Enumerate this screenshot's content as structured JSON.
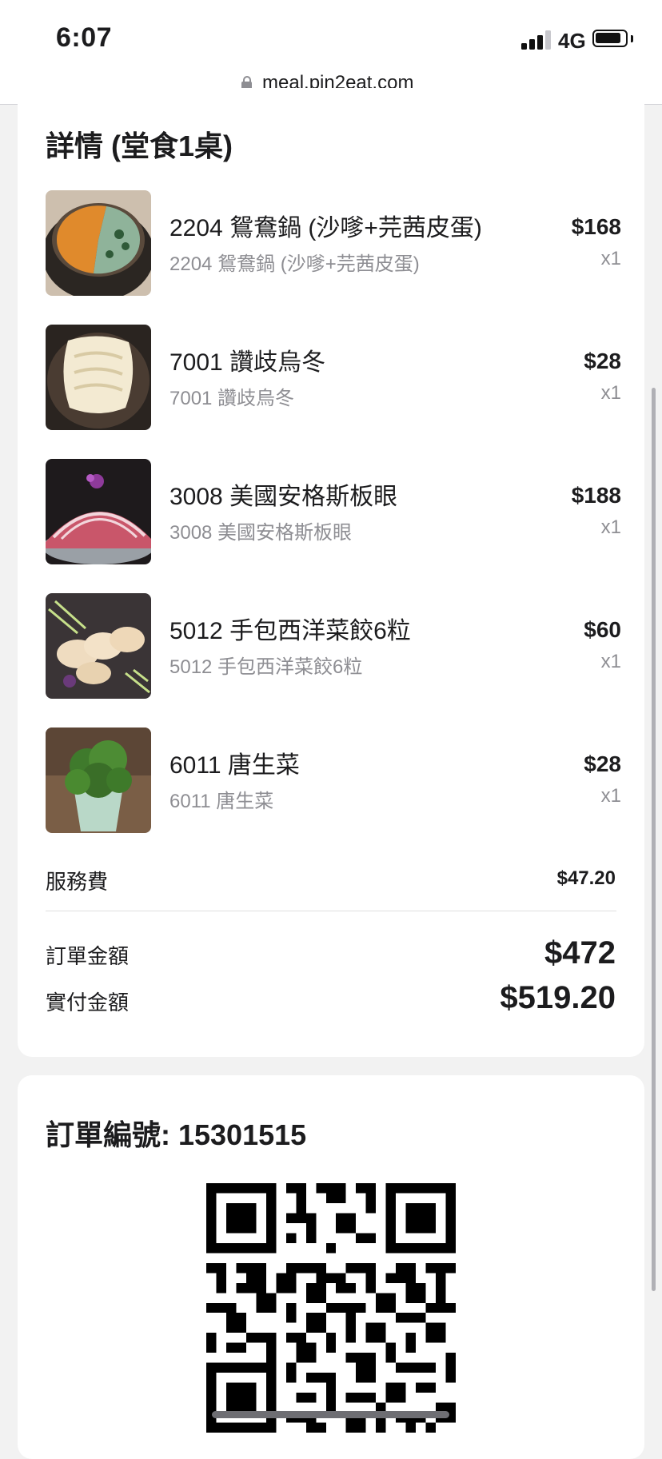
{
  "status_bar": {
    "time": "6:07",
    "network": "4G"
  },
  "url_bar": {
    "url": "meal.pin2eat.com"
  },
  "details": {
    "title": "詳情 (堂食1桌)",
    "items": [
      {
        "name": "2204 鴛鴦鍋 (沙嗲+芫茜皮蛋)",
        "subtitle": "2204 鴛鴦鍋 (沙嗲+芫茜皮蛋)",
        "price": "$168",
        "qty": "x1",
        "image": "hotpot-broth-image"
      },
      {
        "name": "7001 讚歧烏冬",
        "subtitle": "7001 讚歧烏冬",
        "price": "$28",
        "qty": "x1",
        "image": "udon-noodle-image"
      },
      {
        "name": "3008 美國安格斯板眼",
        "subtitle": "3008 美國安格斯板眼",
        "price": "$188",
        "qty": "x1",
        "image": "sliced-beef-image"
      },
      {
        "name": "5012 手包西洋菜餃6粒",
        "subtitle": "5012 手包西洋菜餃6粒",
        "price": "$60",
        "qty": "x1",
        "image": "dumplings-image"
      },
      {
        "name": "6011 唐生菜",
        "subtitle": "6011 唐生菜",
        "price": "$28",
        "qty": "x1",
        "image": "lettuce-image"
      }
    ],
    "service_fee_label": "服務費",
    "service_fee_value": "$47.20",
    "order_amount_label": "訂單金額",
    "order_amount_value": "$472",
    "paid_amount_label": "實付金額",
    "paid_amount_value": "$519.20"
  },
  "order": {
    "title": "訂單編號: 15301515",
    "qr_icon": "qr-code-icon"
  },
  "colors": {
    "background": "#f2f2f2",
    "card": "#ffffff",
    "muted_text": "#8e8e93"
  }
}
